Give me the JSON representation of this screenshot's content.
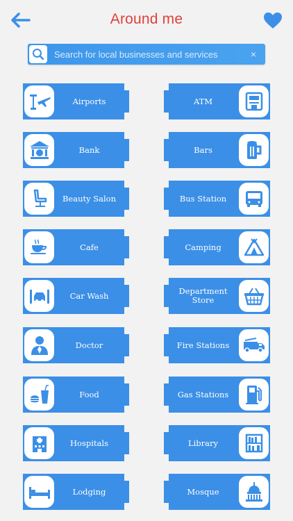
{
  "header": {
    "title": "Around me",
    "back_icon": "arrow-left-icon",
    "favorite_icon": "heart-icon"
  },
  "search": {
    "placeholder": "Search for local businesses and services",
    "value": "",
    "clear_glyph": "×"
  },
  "colors": {
    "title": "#e0413a",
    "accent": "#3d96ea",
    "icon": "#3b8fe6"
  },
  "categories": [
    {
      "label": "Airports",
      "icon": "airport-icon"
    },
    {
      "label": "ATM",
      "icon": "atm-icon"
    },
    {
      "label": "Bank",
      "icon": "bank-icon"
    },
    {
      "label": "Bars",
      "icon": "beer-icon"
    },
    {
      "label": "Beauty Salon",
      "icon": "salon-chair-icon"
    },
    {
      "label": "Bus Station",
      "icon": "bus-icon"
    },
    {
      "label": "Cafe",
      "icon": "coffee-cup-icon"
    },
    {
      "label": "Camping",
      "icon": "tent-icon"
    },
    {
      "label": "Car Wash",
      "icon": "car-wash-icon"
    },
    {
      "label": "Department\nStore",
      "icon": "basket-icon"
    },
    {
      "label": "Doctor",
      "icon": "doctor-icon"
    },
    {
      "label": "Fire Stations",
      "icon": "fire-truck-icon"
    },
    {
      "label": "Food",
      "icon": "fast-food-icon"
    },
    {
      "label": "Gas Stations",
      "icon": "gas-pump-icon"
    },
    {
      "label": "Hospitals",
      "icon": "hospital-icon"
    },
    {
      "label": "Library",
      "icon": "bookshelf-icon"
    },
    {
      "label": "Lodging",
      "icon": "bed-icon"
    },
    {
      "label": "Mosque",
      "icon": "mosque-icon"
    }
  ]
}
